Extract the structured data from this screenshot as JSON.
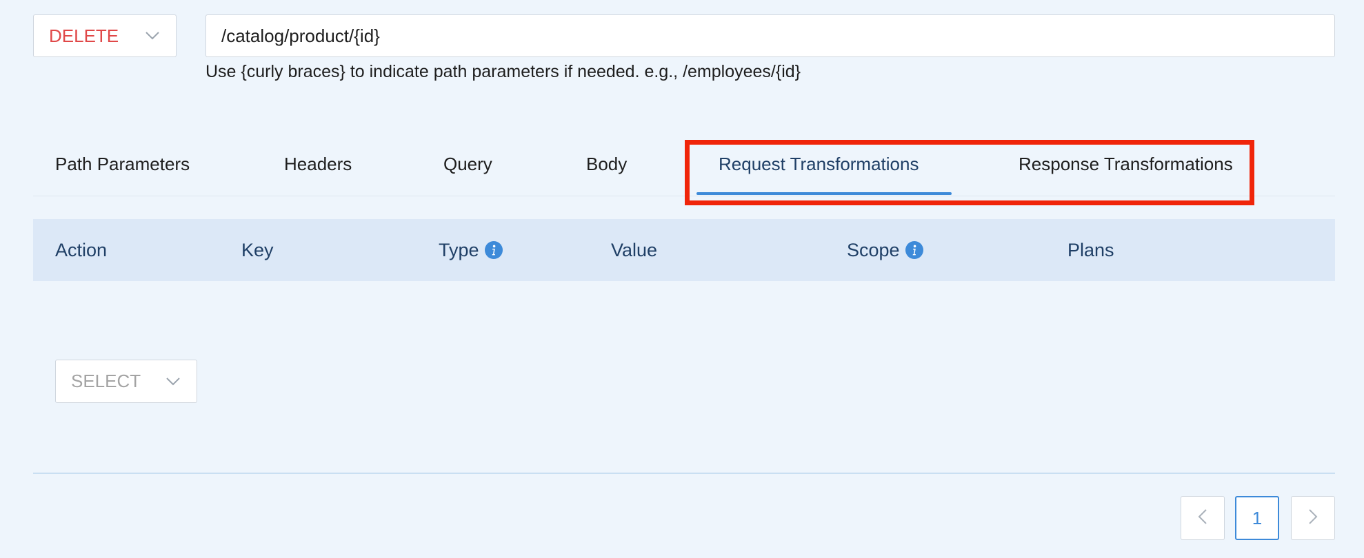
{
  "method": {
    "value": "DELETE",
    "color": "#e04848"
  },
  "path": {
    "value": "/catalog/product/{id}",
    "hint": "Use {curly braces} to indicate path parameters if needed. e.g., /employees/{id}"
  },
  "tabs": [
    {
      "label": "Path Parameters",
      "active": false
    },
    {
      "label": "Headers",
      "active": false
    },
    {
      "label": "Query",
      "active": false
    },
    {
      "label": "Body",
      "active": false
    },
    {
      "label": "Request Transformations",
      "active": true
    },
    {
      "label": "Response Transformations",
      "active": false
    }
  ],
  "table": {
    "columns": [
      {
        "label": "Action",
        "info": false
      },
      {
        "label": "Key",
        "info": false
      },
      {
        "label": "Type",
        "info": true
      },
      {
        "label": "Value",
        "info": false
      },
      {
        "label": "Scope",
        "info": true
      },
      {
        "label": "Plans",
        "info": false
      }
    ]
  },
  "action_select": {
    "placeholder": "SELECT"
  },
  "pagination": {
    "current_page": "1"
  },
  "colors": {
    "accent": "#3d8ad9",
    "highlight": "#f0250a",
    "header_bg": "#dce8f7",
    "page_bg": "#eef5fc"
  }
}
